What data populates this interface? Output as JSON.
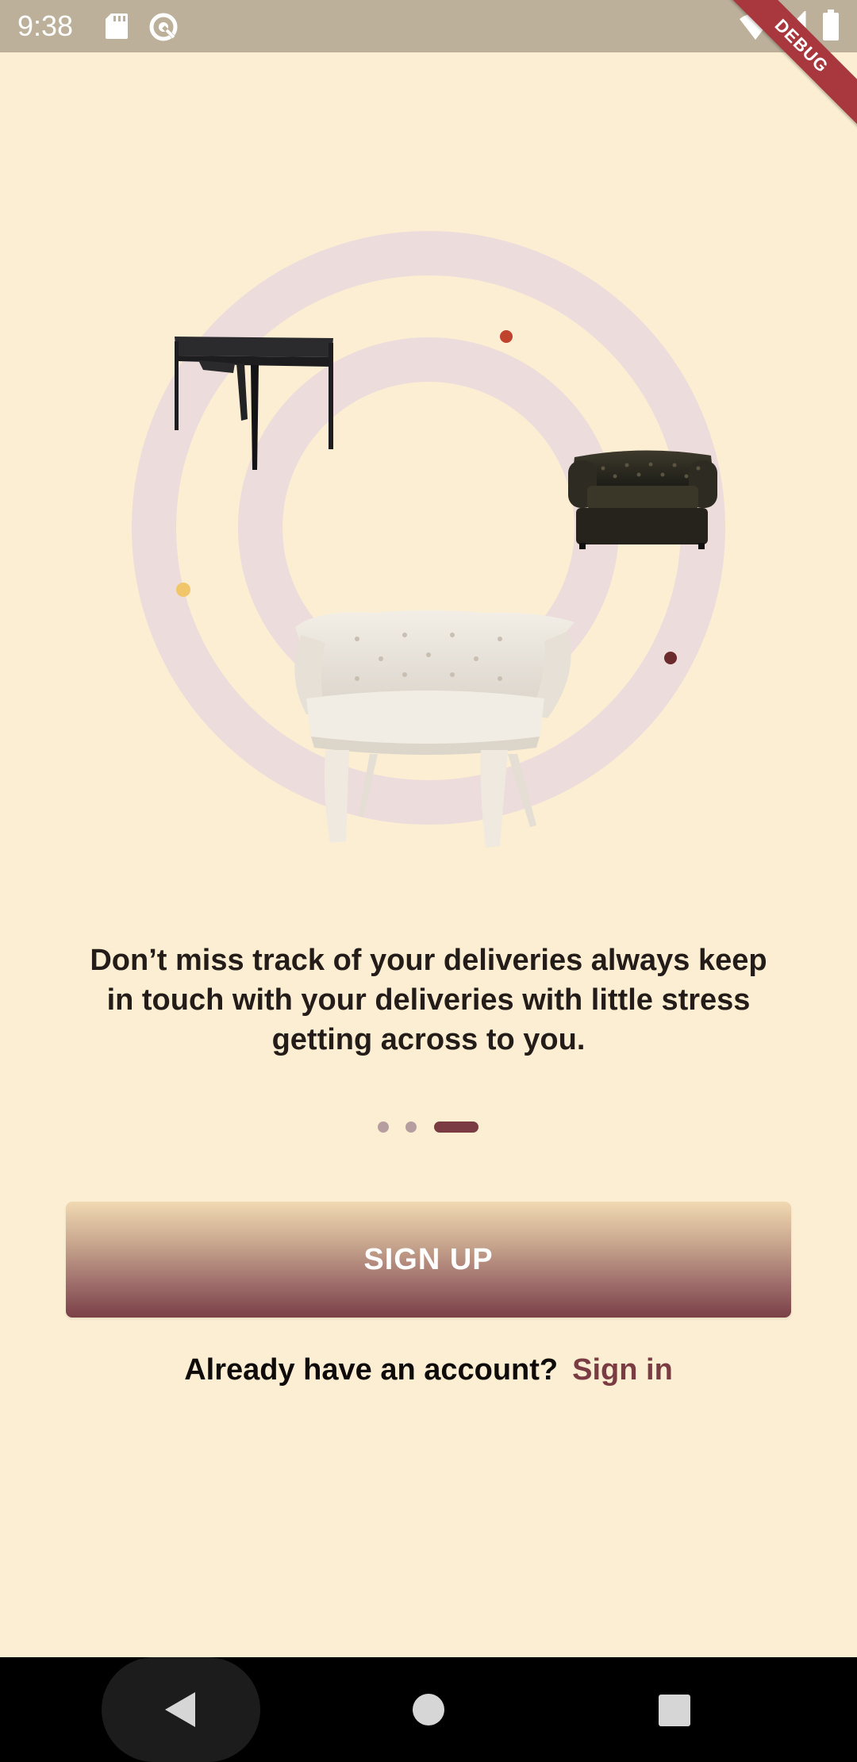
{
  "status_bar": {
    "time": "9:38",
    "icons": [
      "sd-card-icon",
      "data-saver-icon",
      "wifi-icon",
      "signal-icon",
      "battery-icon"
    ],
    "debug_label": "DEBUG",
    "background": "#bcb09a"
  },
  "onboarding": {
    "illustration": {
      "items": [
        "desk-icon",
        "chesterfield-sofa-icon",
        "tufted-armchair-icon"
      ],
      "ring_color": "#ecdcdc",
      "dot_colors": [
        "#c0432d",
        "#f1c66b",
        "#6b2a2c"
      ]
    },
    "description": "Don’t miss track of your deliveries always keep in touch with your deliveries with little stress getting across to you.",
    "page_indicator": {
      "total": 3,
      "active_index": 2,
      "active_color": "#7a3c42",
      "inactive_color": "#b69ea0"
    },
    "signup_label": "SIGN UP",
    "signin_prompt": "Already have an account?",
    "signin_link": "Sign in"
  },
  "nav_bar": {
    "buttons": [
      "back-icon",
      "home-icon",
      "recents-icon"
    ]
  },
  "colors": {
    "background": "#fbeed3",
    "accent": "#7a3c42",
    "text": "#231c18"
  }
}
